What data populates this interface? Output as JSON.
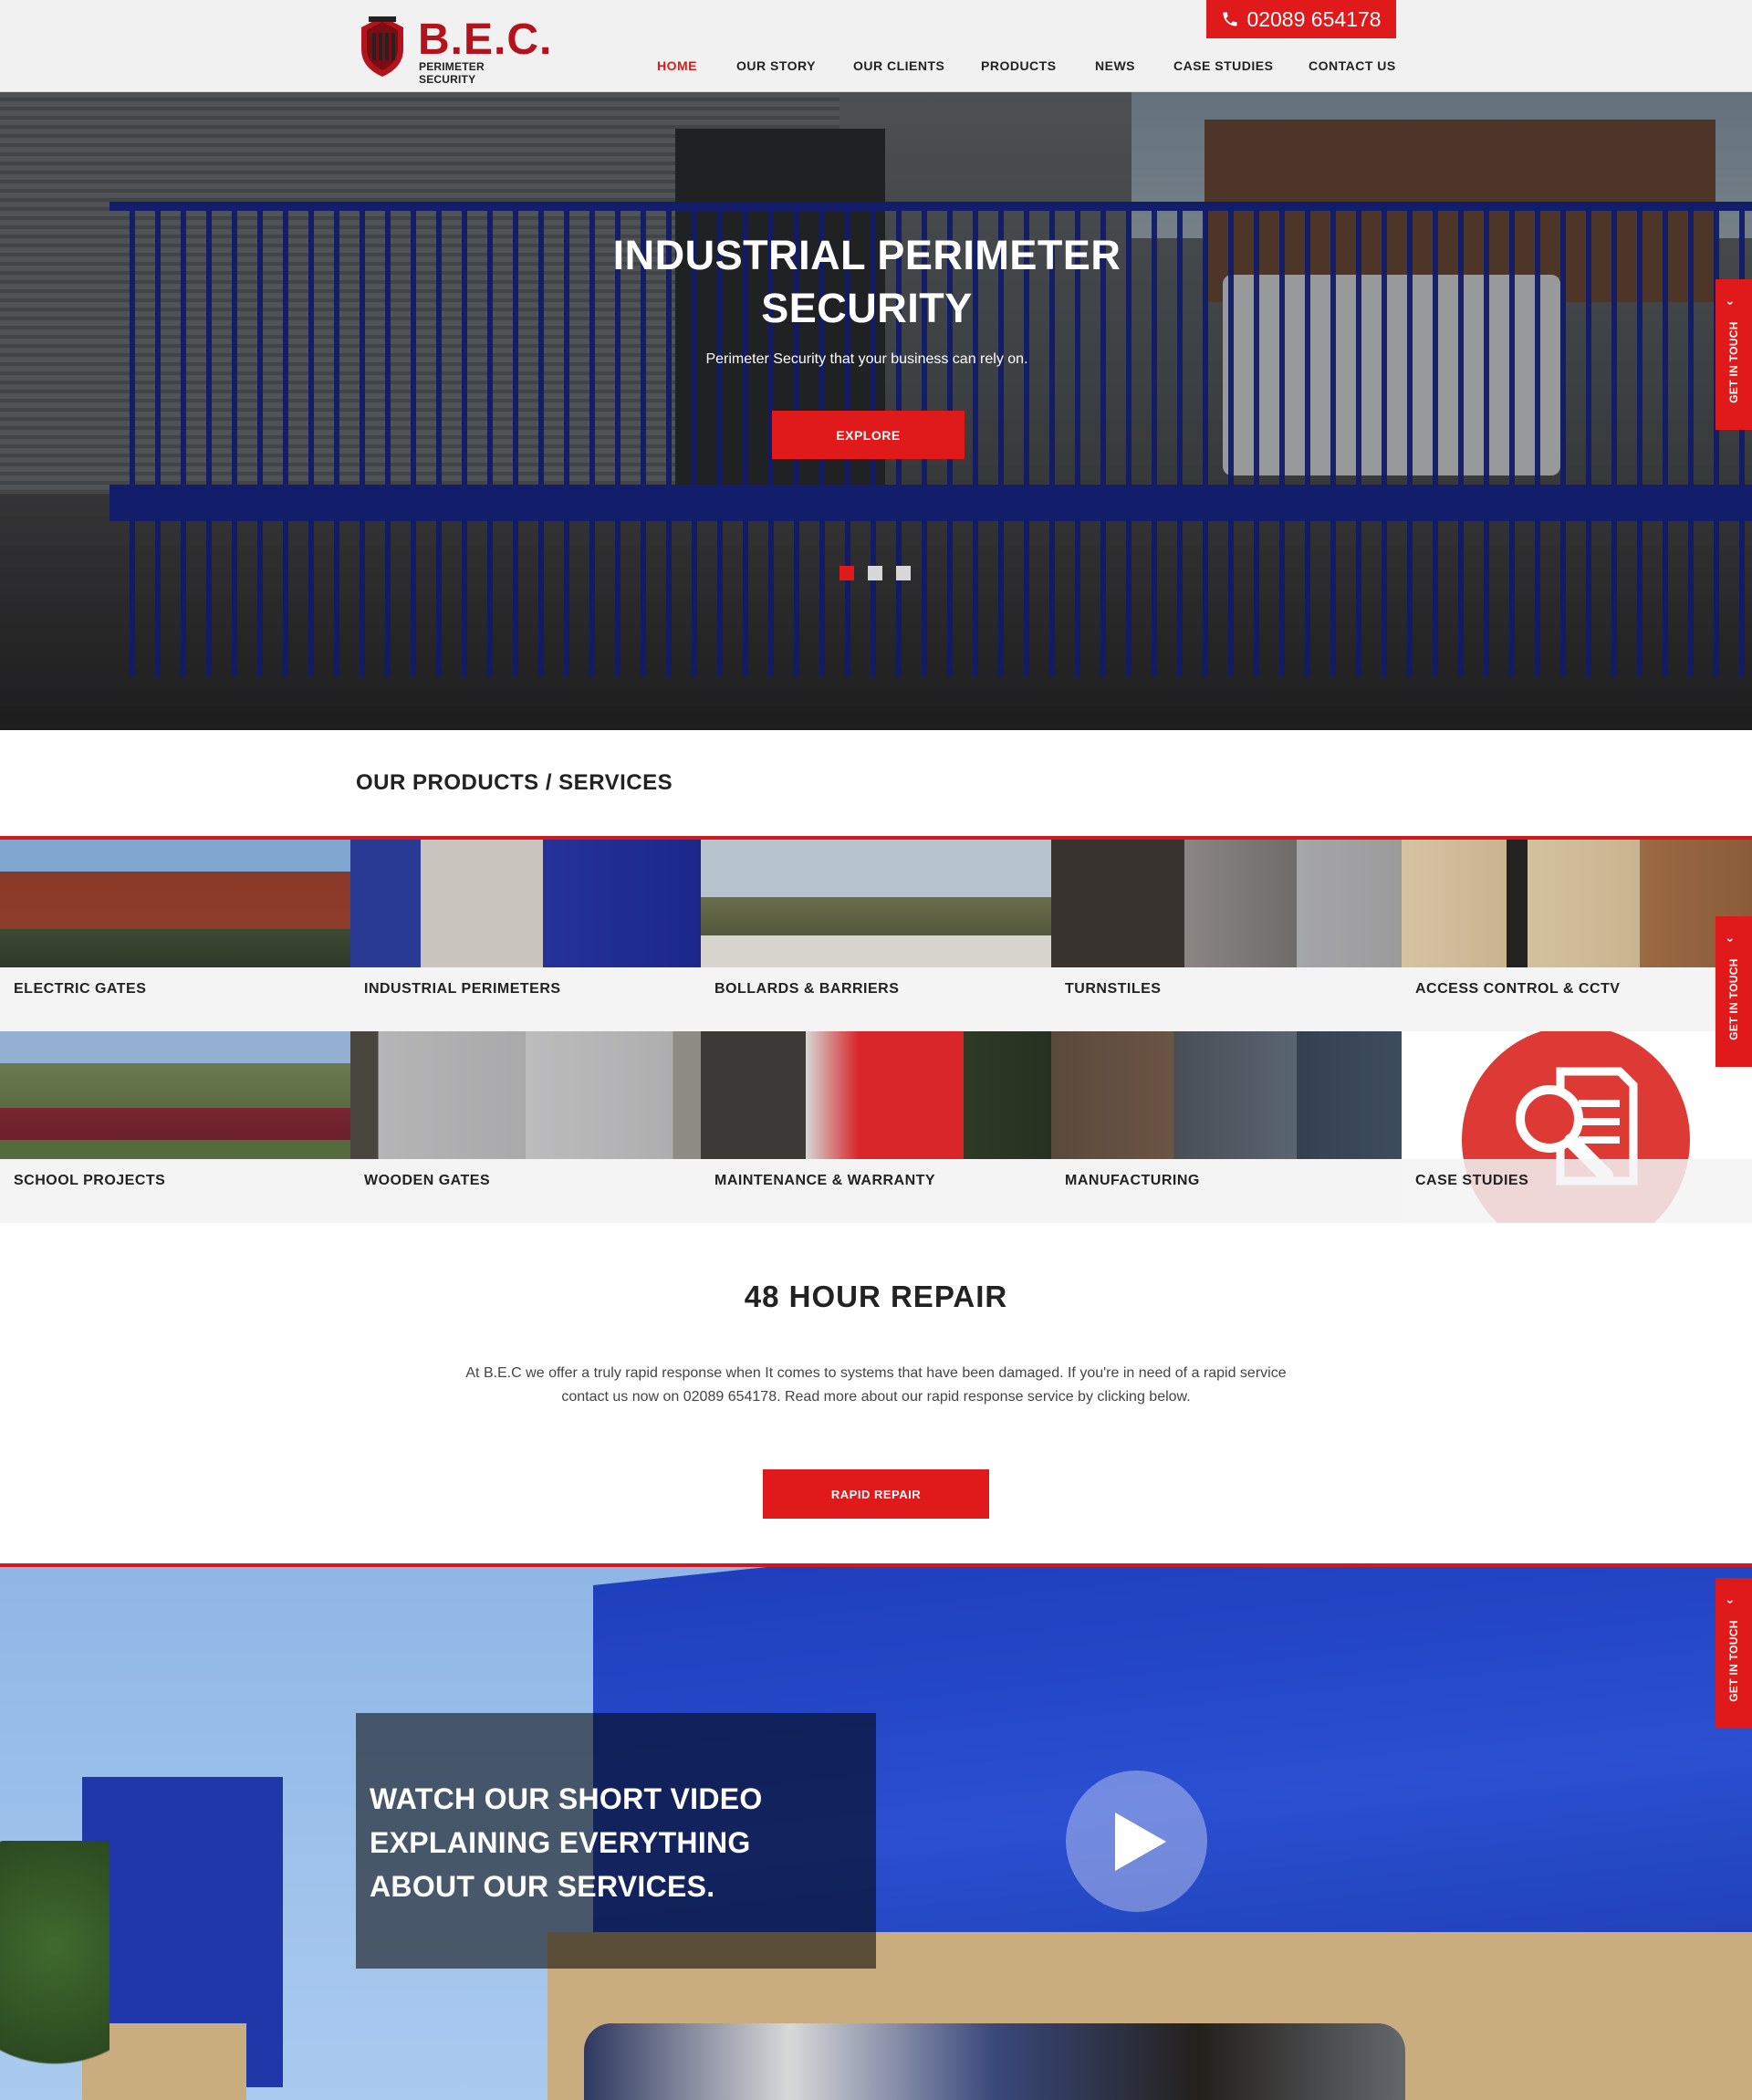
{
  "header": {
    "logo_text": "B.E.C.",
    "logo_sub": "PERIMETER SECURITY",
    "phone": "02089 654178",
    "nav": [
      "HOME",
      "OUR STORY",
      "OUR CLIENTS",
      "PRODUCTS",
      "NEWS",
      "CASE STUDIES",
      "CONTACT US"
    ],
    "active_nav": "HOME"
  },
  "hero": {
    "title": "INDUSTRIAL PERIMETER SECURITY",
    "subtitle": "Perimeter Security that your business can rely on.",
    "button": "EXPLORE",
    "slides": 3,
    "active_slide": 1
  },
  "side_tab": {
    "label": "GET IN TOUCH"
  },
  "products": {
    "title": "OUR PRODUCTS / SERVICES",
    "items": [
      "ELECTRIC GATES",
      "INDUSTRIAL PERIMETERS",
      "BOLLARDS & BARRIERS",
      "TURNSTILES",
      "ACCESS CONTROL & CCTV",
      "SCHOOL PROJECTS",
      "WOODEN GATES",
      "MAINTENANCE & WARRANTY",
      "MANUFACTURING",
      "CASE STUDIES"
    ]
  },
  "repair": {
    "title": "48 HOUR REPAIR",
    "text": "At B.E.C we offer a truly rapid response when It comes to systems that have been damaged. If you're in need of a rapid service contact us now on 02089 654178. Read more about our rapid response service by clicking below.",
    "button": "RAPID REPAIR"
  },
  "video": {
    "text": "WATCH OUR SHORT VIDEO EXPLAINING EVERYTHING ABOUT OUR SERVICES."
  },
  "colors": {
    "brand_red": "#e01a1a",
    "logo_red": "#b3131c",
    "text_dark": "#222222"
  },
  "icons": [
    "phone-icon",
    "play-icon",
    "chevron-up-icon",
    "magnifier-document-icon"
  ]
}
